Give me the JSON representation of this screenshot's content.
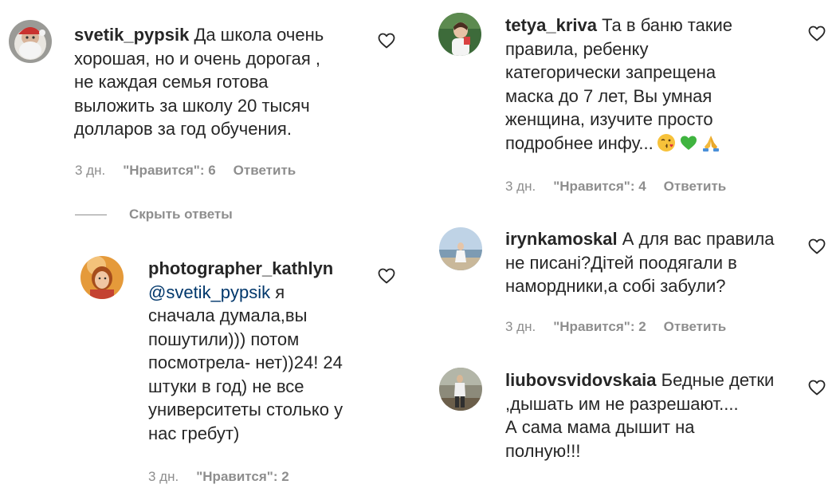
{
  "comments": [
    {
      "username": "svetik_pypsik",
      "lines": [
        "Да школа очень",
        "хорошая, но и очень дорогая ,",
        "не каждая семья готова",
        "выложить за школу 20 тысяч",
        "долларов за год обучения."
      ],
      "time": "3 дн.",
      "likes": "\"Нравится\": 6",
      "reply": "Ответить"
    },
    {
      "username": "photographer_kathlyn",
      "mention": "@svetik_pypsik",
      "lines": [
        "я",
        "сначала думала,вы",
        "пошутили))) потом",
        "посмотрела- нет))24! 24",
        "штуки в год) не все",
        "университеты столько у",
        "нас гребут)"
      ],
      "time": "3 дн.",
      "likes": "\"Нравится\": 2"
    },
    {
      "username": "tetya_kriva",
      "lines": [
        "Та в баню такие",
        "правила, ребенку",
        "категорически запрещена",
        "маска до 7 лет, Вы умная",
        "женщина, изучите просто",
        "подробнее инфу..."
      ],
      "emojis": [
        "kissing-face-emoji",
        "green-heart-emoji",
        "praying-hands-emoji"
      ],
      "time": "3 дн.",
      "likes": "\"Нравится\": 4",
      "reply": "Ответить"
    },
    {
      "username": "irynkamoskal",
      "lines": [
        "А для вас правила",
        "не писані?Дітей поодягали в",
        "намордники,а собі забули?"
      ],
      "time": "3 дн.",
      "likes": "\"Нравится\": 2",
      "reply": "Ответить"
    },
    {
      "username": "liubovsvidovskaia",
      "lines": [
        "Бедные детки",
        ",дышать им не разрешают....",
        "А сама мама дышит на",
        "полную!!!"
      ],
      "time": "",
      "likes": "",
      "reply": ""
    }
  ],
  "hide_replies": "Скрыть ответы",
  "icons": {
    "like": "heart-outline-icon"
  },
  "colors": {
    "text": "#262626",
    "muted": "#8e8e8e",
    "mention": "#00376b"
  }
}
